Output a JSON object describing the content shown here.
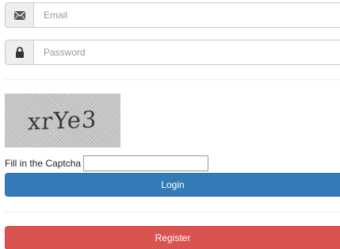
{
  "email": {
    "icon": "envelope-icon",
    "placeholder": "Email",
    "value": ""
  },
  "password": {
    "icon": "lock-icon",
    "placeholder": "Password",
    "value": ""
  },
  "captcha": {
    "text": "xrYe3",
    "label": "Fill in the Captcha",
    "value": ""
  },
  "buttons": {
    "login_label": "Login",
    "register_label": "Register"
  },
  "colors": {
    "login": "#337ab7",
    "register": "#d9534f",
    "addon_bg": "#eeeeee",
    "border": "#cccccc"
  }
}
